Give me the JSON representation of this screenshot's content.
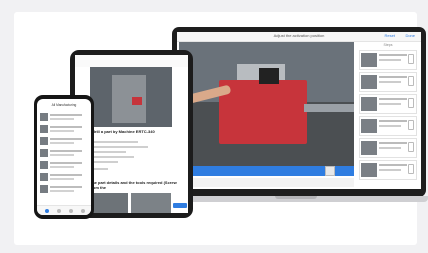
{
  "laptop": {
    "header_title": "Adjust the activation position",
    "reset_label": "Reset",
    "done_label": "Done",
    "sidebar_heading": "Steps"
  },
  "tablet": {
    "article_title": "How to drill a part by Machine ERTC-340",
    "section_title": "Select the part details and the tools required (Screw count from the"
  },
  "phone": {
    "header": "All Manufacturing"
  },
  "colors": {
    "accent": "#2f7de1",
    "machine": "#c7343b"
  }
}
